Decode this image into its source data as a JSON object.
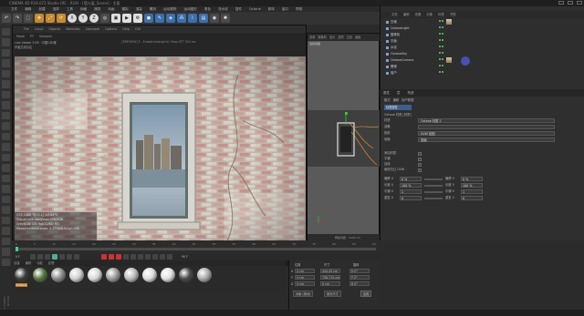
{
  "window": {
    "title": "CINEMA 4D R19.072 Studio (RC - R19) - [墙与窗_Scene] - 主要"
  },
  "menubar": [
    "文件",
    "编辑",
    "创建",
    "选择",
    "工具",
    "网格",
    "捕捉",
    "动画",
    "模拟",
    "渲染",
    "雕刻",
    "运动跟踪",
    "运动图形",
    "角色",
    "流水线",
    "插件",
    "Octane",
    "脚本",
    "窗口",
    "帮助"
  ],
  "toolbar": {
    "icons": [
      "undo-icon",
      "redo-icon",
      "select-icon",
      "move-icon",
      "scale-icon",
      "rotate-icon",
      "x-axis-icon",
      "y-axis-icon",
      "z-axis-icon",
      "world-icon",
      "render-view-icon",
      "render-icon",
      "render-settings-icon",
      "cube-icon",
      "pen-icon",
      "subdivide-icon",
      "array-icon",
      "deform-icon",
      "scene-icon",
      "camera-icon",
      "light-icon"
    ],
    "axis": [
      "X",
      "Y",
      "Z"
    ]
  },
  "viewport": {
    "title": "Live Viewer 3.06 · 中国C4D爱好者交流论坛",
    "menu": [
      "File",
      "Cloud",
      "Objects",
      "Materials",
      "Compare",
      "Options",
      "Help",
      "GUI"
    ],
    "sub": [
      "Mode",
      "PT",
      "Samples"
    ],
    "header_note": "[PREVIEW] 3 - Enable octangl for View GTT 320 ms",
    "stats": [
      "GTX 1080 Ti[13.1]     %5     64°C",
      "Out-of-core used/max:0Kb/4Gb",
      "Grey8/16: 0/0        Rgb32/64: 9/1",
      "Used/free/total vram: 4.174b/6.9Gb/11Gb"
    ],
    "status": "Rendering: 100%   Ms/sec: 0   Time: 00:00:00/00:00:00   Spp/maxspp: 128/128   Tri: 0/1456   Mesh: 1b   Hair: 0"
  },
  "viewport2": {
    "menu": [
      "查看",
      "摄像机",
      "显示",
      "选项",
      "过滤",
      "面板"
    ],
    "label": "透视视图",
    "foot": "网格间距：1000 cm"
  },
  "objects": {
    "tabs": [
      "文件",
      "编辑",
      "查看",
      "对象",
      "标签",
      "书签"
    ],
    "rows": [
      "白墙",
      "OctaneLight",
      "摄像机",
      "平面",
      "水泥",
      "OctaneSky",
      "OctaneCamera",
      "栅墙",
      "窗户"
    ]
  },
  "attr_tabs": [
    "属性",
    "层",
    "构造"
  ],
  "attributes": {
    "mode_row": [
      "模式",
      "编辑",
      "用户数据"
    ],
    "section": "标签属性",
    "tag_label": "Octane 材质 [材质]",
    "rows": [
      {
        "label": "材质",
        "value": "Octane 材质 2"
      },
      {
        "label": "选集",
        "value": ""
      },
      {
        "label": "投射",
        "value": "UVW 贴图"
      },
      {
        "label": "侧面",
        "value": "双面"
      }
    ],
    "checks": [
      "添加材质",
      "平铺",
      "连续",
      "使用凹凸 UVW"
    ],
    "offset": [
      {
        "label": "偏移 U",
        "a": "0 %",
        "b": "偏移 V",
        "c": "0 %"
      },
      {
        "label": "长度 U",
        "a": "100 %",
        "b": "长度 V",
        "c": "100 %"
      },
      {
        "label": "平铺 U",
        "a": "1",
        "b": "平铺 V",
        "c": "1"
      },
      {
        "label": "重复 U",
        "a": "0",
        "b": "重复 V",
        "c": "0"
      }
    ]
  },
  "timeline": {
    "ticks": [
      "0",
      "5",
      "10",
      "15",
      "20",
      "25",
      "30",
      "35",
      "40",
      "45",
      "50",
      "55",
      "60",
      "65",
      "70",
      "75",
      "80",
      "85",
      "90"
    ],
    "current": "0 F",
    "end": "90 F"
  },
  "materials": {
    "menu": [
      "创建",
      "编辑",
      "功能",
      "纹理"
    ],
    "active": "OcBane"
  },
  "coords": {
    "headers": [
      "位置",
      "尺寸",
      "旋转"
    ],
    "rows": [
      {
        "axis": "X",
        "pos": "0 cm",
        "size": "444.45 cm",
        "rot": "H 0°"
      },
      {
        "axis": "Y",
        "pos": "0 cm",
        "size": "758.774 cm",
        "rot": "P 0°"
      },
      {
        "axis": "Z",
        "pos": "0 cm",
        "size": "0 cm",
        "rot": "B 0°"
      }
    ],
    "mode": "对象 (相对)",
    "mode2": "绝对尺寸",
    "apply": "应用"
  },
  "watermark": "MAXON CINEMA 4D"
}
